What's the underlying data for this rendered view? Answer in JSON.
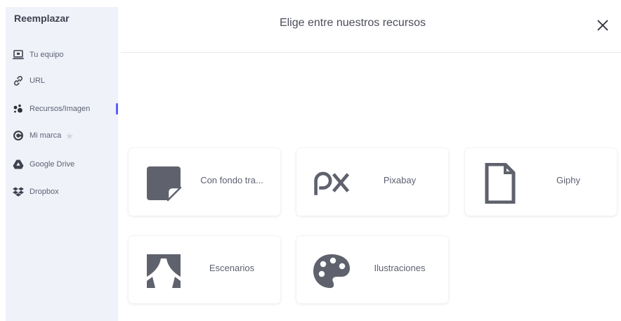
{
  "sidebar": {
    "title": "Reemplazar",
    "items": [
      {
        "label": "Tu equipo",
        "icon": "laptop-icon"
      },
      {
        "label": "URL",
        "icon": "link-icon"
      },
      {
        "label": "Recursos/Imagen",
        "icon": "resources-icon",
        "active": true
      },
      {
        "label": "Mi marca",
        "icon": "brand-icon",
        "badge_icon": "star-icon"
      },
      {
        "label": "Google Drive",
        "icon": "google-drive-icon"
      },
      {
        "label": "Dropbox",
        "icon": "dropbox-icon"
      }
    ],
    "active_color": "#5b5ef6"
  },
  "header": {
    "title": "Elige entre nuestros recursos",
    "close_icon": "close-icon"
  },
  "cards": [
    {
      "label": "Con fondo tra...",
      "icon": "sticker-icon"
    },
    {
      "label": "Pixabay",
      "icon": "pixabay-logo-icon"
    },
    {
      "label": "Giphy",
      "icon": "giphy-file-icon"
    },
    {
      "label": "Escenarios",
      "icon": "stage-curtain-icon"
    },
    {
      "label": "Ilustraciones",
      "icon": "palette-icon"
    }
  ]
}
